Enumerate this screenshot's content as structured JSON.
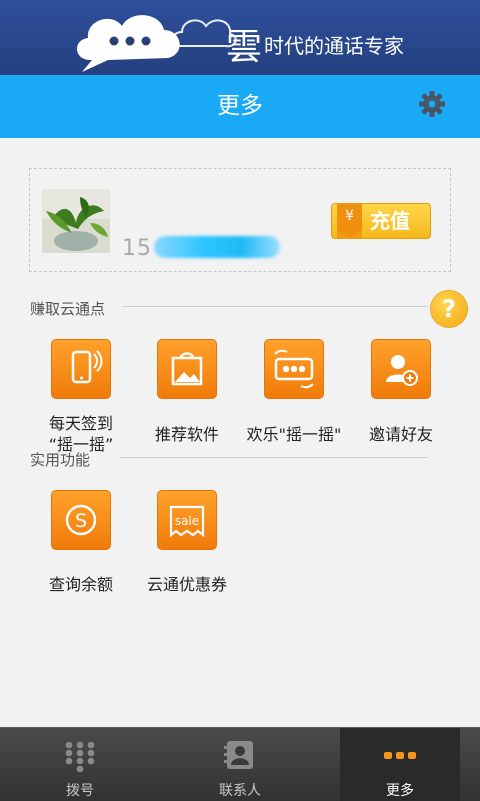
{
  "banner": {
    "brand_char": "雲",
    "slogan": "时代的通话专家"
  },
  "header": {
    "title": "更多"
  },
  "account": {
    "phone_visible_prefix": "15"
  },
  "recharge": {
    "currency_symbol": "¥",
    "label": "充值"
  },
  "sections": {
    "earn": {
      "title": "赚取云通点",
      "help_symbol": "?",
      "items": [
        {
          "label_line1": "每天签到",
          "label_line2": "“摇一摇”"
        },
        {
          "label": "推荐软件"
        },
        {
          "label": "欢乐\"摇一摇\""
        },
        {
          "label": "邀请好友"
        }
      ]
    },
    "tools": {
      "title": "实用功能",
      "items": [
        {
          "label": "查询余额",
          "icon_symbol": "S"
        },
        {
          "label": "云通优惠券",
          "icon_text": "sale"
        }
      ]
    }
  },
  "bottom_nav": [
    {
      "label": "拨号",
      "icon": "dialpad-icon"
    },
    {
      "label": "联系人",
      "icon": "contacts-icon"
    },
    {
      "label": "更多",
      "icon": "more-icon",
      "active": true
    }
  ],
  "colors": {
    "header_blue": "#19a9f5",
    "banner_blue": "#2f4f9c",
    "tile_orange": "#f58f16",
    "active_nav_accent": "#f7941d"
  }
}
